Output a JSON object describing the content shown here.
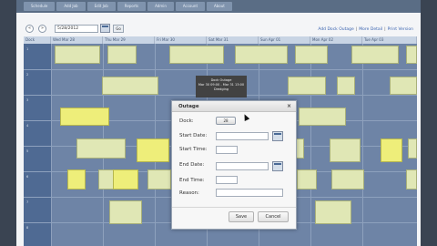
{
  "nav": {
    "items": [
      "Schedule",
      "Add Job",
      "Edit Job",
      "Reports",
      "Admin",
      "Account",
      "About"
    ]
  },
  "toolbar": {
    "prev_icon": "«",
    "next_icon": "»",
    "date_value": "5/28/2012",
    "go_label": "Go",
    "links": [
      "Add Dock Outage",
      "More Detail",
      "Print Version"
    ],
    "link_separator": "|"
  },
  "calendar": {
    "headers": [
      "Dock",
      "Wed Mar 28",
      "Thu Mar 29",
      "Fri Mar 30",
      "Sat Mar 31",
      "Sun Apr 01",
      "Mon Apr 02",
      "Tue Apr 03"
    ],
    "dock_numbers": [
      "1",
      "2",
      "3",
      "4",
      "5",
      "6",
      "7",
      "8"
    ]
  },
  "tooltip": {
    "line1": "Dock Outage",
    "line2": "Mar 30 09:00 - Mar 31 13:00",
    "line3": "Dredging"
  },
  "dialog": {
    "title": "Outage",
    "close_icon": "×",
    "dock_label": "Dock:",
    "dock_value": "28",
    "start_date_label": "Start Date:",
    "start_time_label": "Start Time:",
    "end_date_label": "End Date:",
    "end_time_label": "End Time:",
    "reason_label": "Reason:",
    "save_label": "Save",
    "cancel_label": "Cancel"
  }
}
